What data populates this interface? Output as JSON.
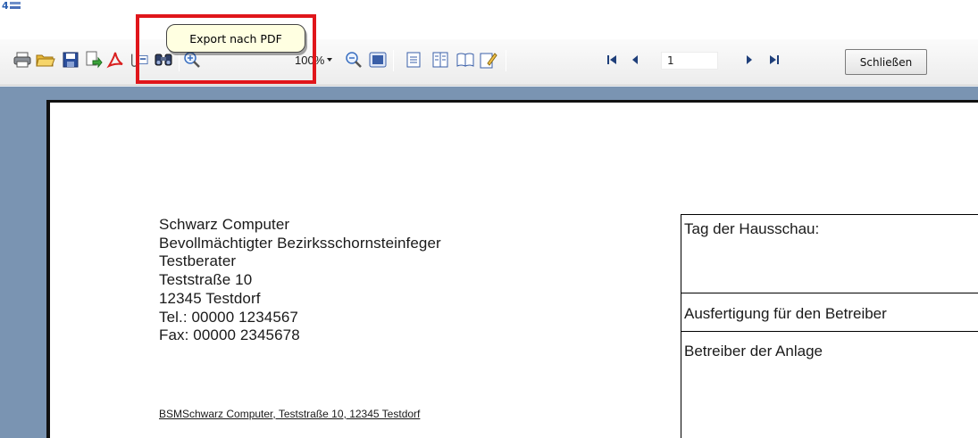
{
  "toolbar": {
    "buttons": [
      {
        "name": "print",
        "icon": "printer-icon"
      },
      {
        "name": "open",
        "icon": "folder-open-icon"
      },
      {
        "name": "save",
        "icon": "floppy-disk-icon"
      },
      {
        "name": "export",
        "icon": "export-document-icon"
      },
      {
        "name": "export-pdf",
        "icon": "pdf-icon"
      },
      {
        "name": "attach",
        "icon": "paperclip-icon"
      },
      {
        "name": "find",
        "icon": "binoculars-icon"
      },
      {
        "name": "zoom-in",
        "icon": "zoom-in-icon"
      },
      {
        "name": "zoom-out",
        "icon": "zoom-out-icon"
      },
      {
        "name": "page-view",
        "icon": "page-view-icon"
      },
      {
        "name": "single-page",
        "icon": "single-page-icon"
      },
      {
        "name": "multiple-pages",
        "icon": "multiple-pages-icon"
      },
      {
        "name": "book-view",
        "icon": "book-icon"
      },
      {
        "name": "edit-page",
        "icon": "edit-page-icon"
      },
      {
        "name": "first-page",
        "icon": "first-page-icon"
      },
      {
        "name": "previous-page",
        "icon": "previous-page-icon"
      },
      {
        "name": "next-page",
        "icon": "next-page-icon"
      },
      {
        "name": "last-page",
        "icon": "last-page-icon"
      }
    ],
    "zoom_value": "100%",
    "page_number": "1",
    "close_label": "Schließen"
  },
  "tooltip": {
    "text": "Export nach PDF"
  },
  "document": {
    "address": {
      "company": "Schwarz Computer",
      "role": "Bevollmächtigter Bezirksschornsteinfeger",
      "name": "Testberater",
      "street": "Teststraße 10",
      "city": "12345 Testdorf",
      "phone": "Tel.: 00000 1234567",
      "fax": "Fax: 00000 2345678"
    },
    "sender_line": "BSMSchwarz Computer, Teststraße 10, 12345 Testdorf",
    "info_box": {
      "inspection_date_label": "Tag der Hausschau:",
      "copy_label": "Ausfertigung für den Betreiber",
      "operator_label": "Betreiber der Anlage"
    }
  },
  "colors": {
    "highlight": "#e0161b",
    "viewer_background": "#7a94b2",
    "tooltip_background": "#ffffe1"
  }
}
